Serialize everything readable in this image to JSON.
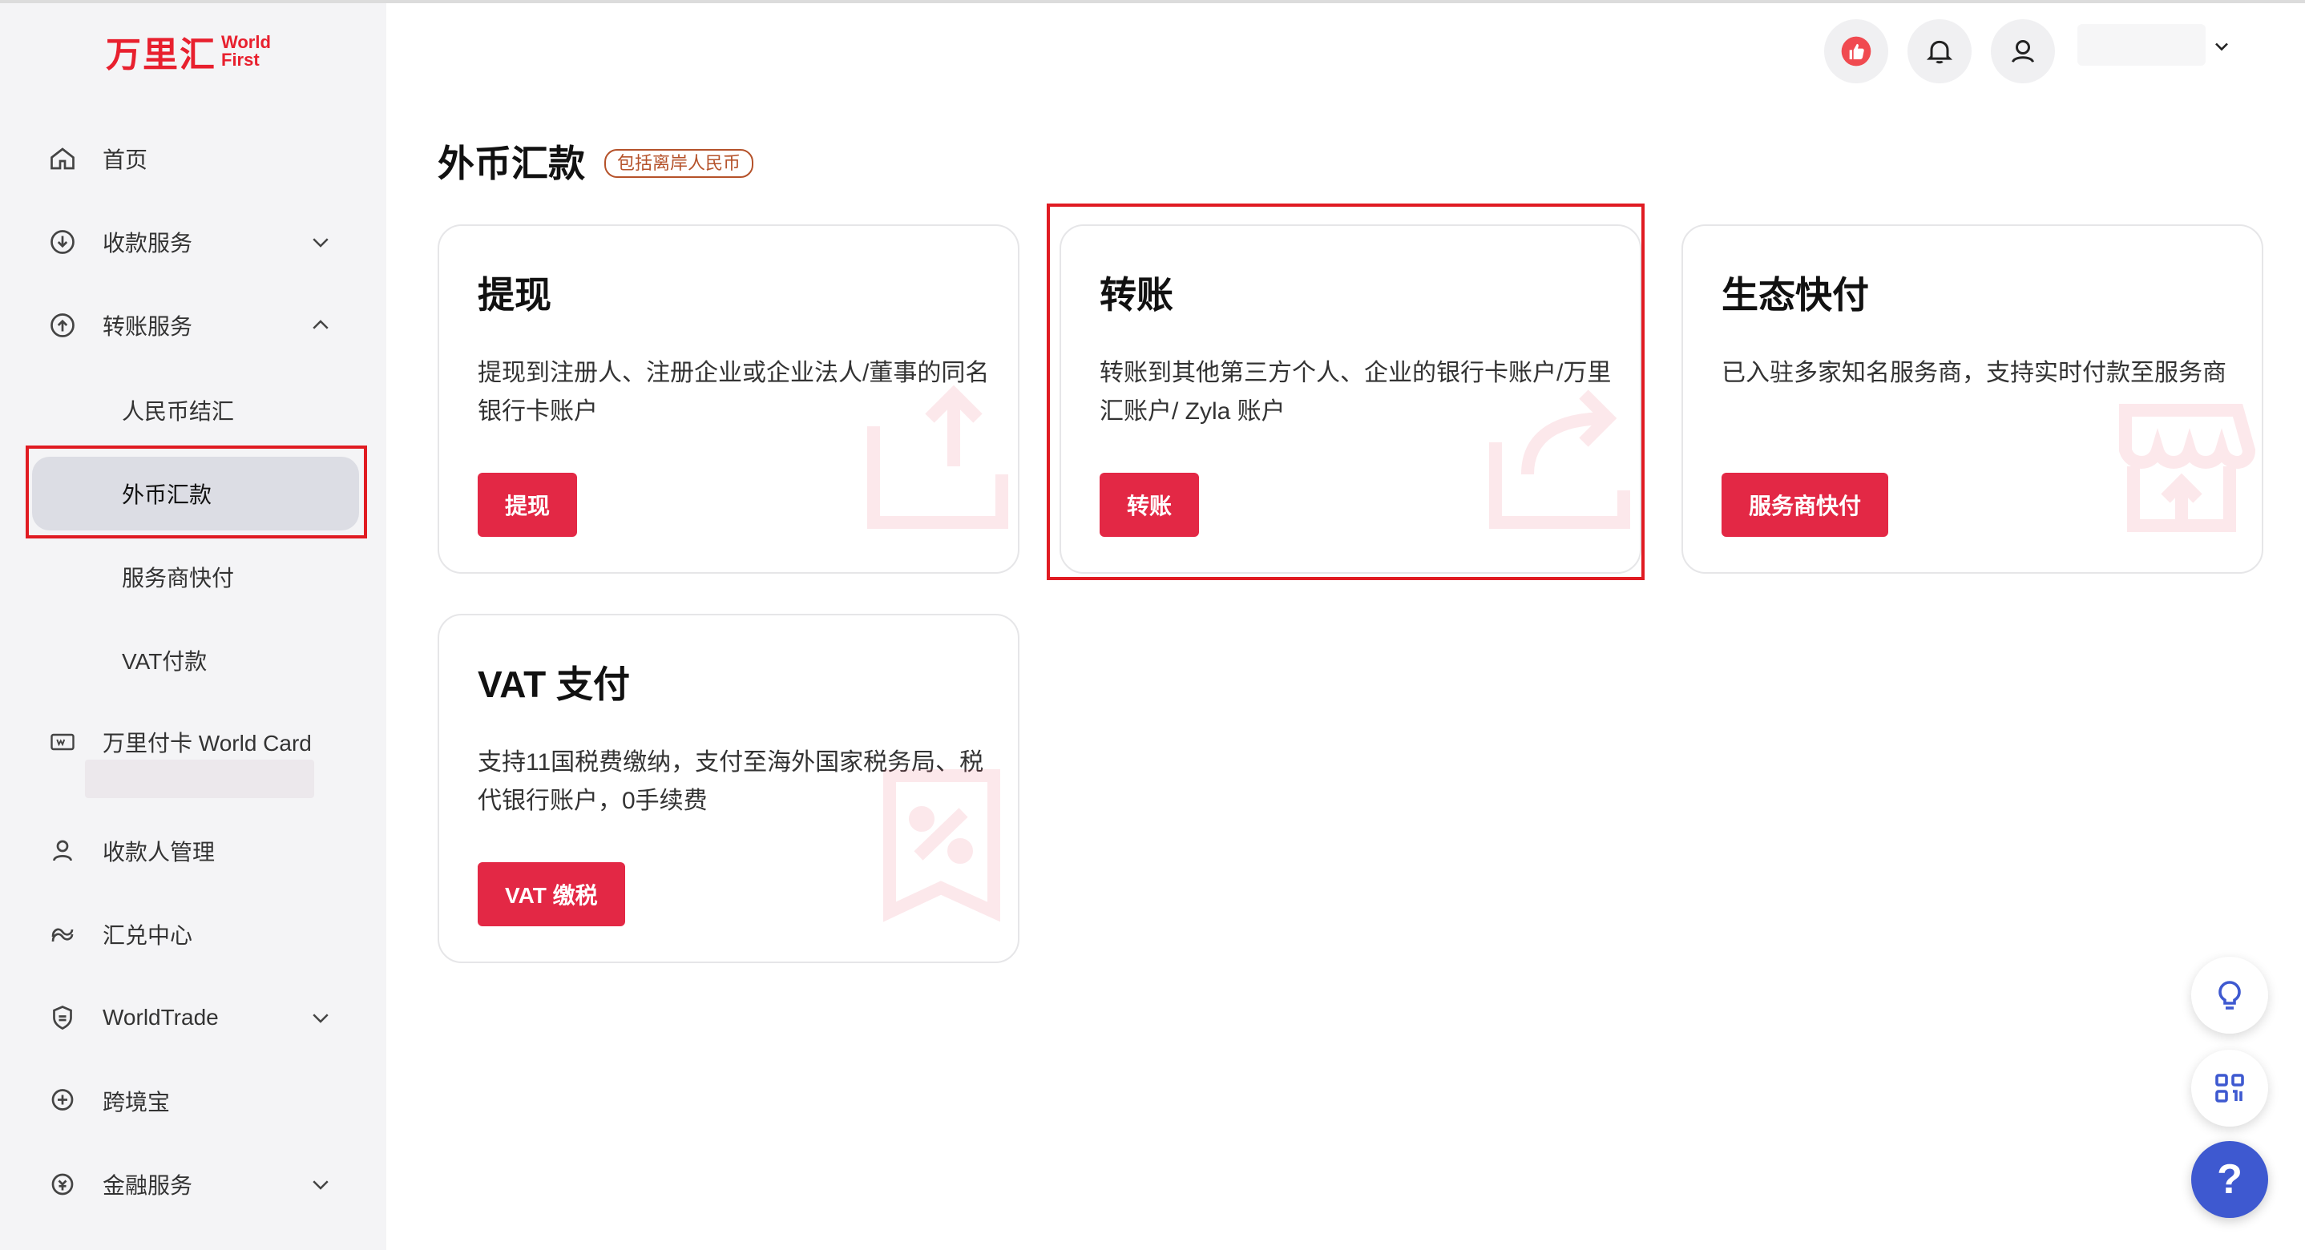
{
  "logo": {
    "cn": "万里汇",
    "en_line1": "World",
    "en_line2": "First"
  },
  "sidebar": {
    "items": [
      {
        "label": "首页",
        "icon": "home-icon"
      },
      {
        "label": "收款服务",
        "icon": "receive-icon",
        "chevron": "down"
      },
      {
        "label": "转账服务",
        "icon": "transfer-icon",
        "chevron": "up"
      },
      {
        "label": "万里付卡 World Card",
        "icon": "card-icon"
      },
      {
        "label": "收款人管理",
        "icon": "payee-icon"
      },
      {
        "label": "汇兑中心",
        "icon": "exchange-icon"
      },
      {
        "label": "WorldTrade",
        "icon": "shield-icon",
        "chevron": "down"
      },
      {
        "label": "跨境宝",
        "icon": "kjb-icon"
      },
      {
        "label": "金融服务",
        "icon": "finance-icon",
        "chevron": "down"
      }
    ],
    "subitems": [
      {
        "label": "人民币结汇"
      },
      {
        "label": "外币汇款",
        "active": true
      },
      {
        "label": "服务商快付"
      },
      {
        "label": "VAT付款"
      }
    ]
  },
  "header": {
    "icons": [
      "thumbs-up-icon",
      "bell-icon",
      "user-icon",
      "chevron-down-icon"
    ]
  },
  "main": {
    "title": "外币汇款",
    "badge": "包括离岸人民币",
    "cards": [
      {
        "title": "提现",
        "desc": "提现到注册人、注册企业或企业法人/董事的同名银行卡账户",
        "button": "提现"
      },
      {
        "title": "转账",
        "desc": "转账到其他第三方个人、企业的银行卡账户/万里汇账户/ Zyla 账户",
        "button": "转账"
      },
      {
        "title": "生态快付",
        "desc": "已入驻多家知名服务商，支持实时付款至服务商",
        "button": "服务商快付"
      },
      {
        "title": "VAT 支付",
        "desc": "支持11国税费缴纳，支付至海外国家税务局、税代银行账户，0手续费",
        "button": "VAT 缴税"
      }
    ]
  },
  "float": {
    "help": "?"
  },
  "colors": {
    "brand": "#e8202e",
    "button": "#e32845",
    "help": "#3e59d0",
    "highlight": "#e01b22"
  }
}
